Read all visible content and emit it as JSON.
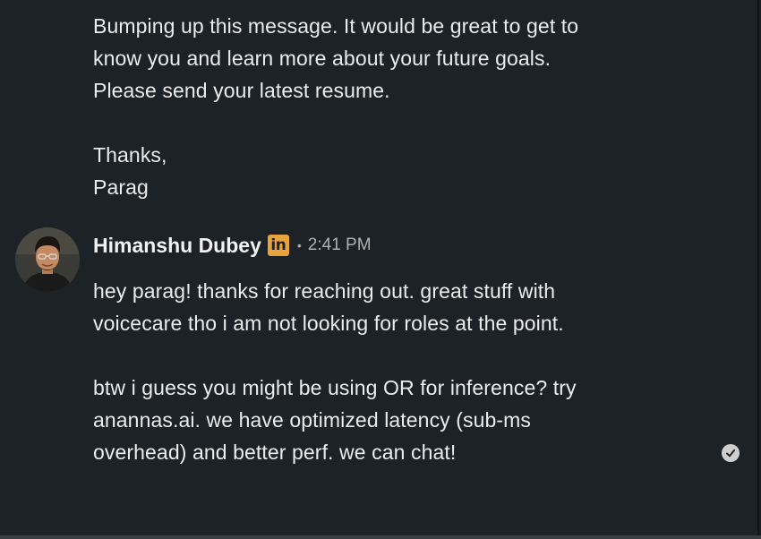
{
  "previous_message": {
    "paragraph_1": [
      "Bumping up this message. It would be great to get to",
      "know you and learn more about your future goals.",
      "Please send your latest resume."
    ],
    "paragraph_2": [
      "Thanks,",
      "Parag"
    ]
  },
  "reply": {
    "sender_name": "Himanshu Dubey",
    "badge_text": "in",
    "separator": "•",
    "timestamp": "2:41 PM",
    "paragraph_1": [
      "hey parag! thanks for reaching out. great stuff with",
      "voicecare tho i am not looking for roles at the point."
    ],
    "paragraph_2": [
      "btw i guess you might be using OR for inference? try",
      "anannas.ai. we have optimized latency (sub-ms",
      "overhead) and better perf. we can chat!"
    ]
  },
  "icons": {
    "avatar": "profile-photo",
    "badge": "linkedin-premium-icon",
    "status": "seen-check-icon"
  },
  "colors": {
    "background": "#1d2226",
    "text": "#ececec",
    "badge": "#e7a33e",
    "timestamp": "#b0b0b0"
  }
}
